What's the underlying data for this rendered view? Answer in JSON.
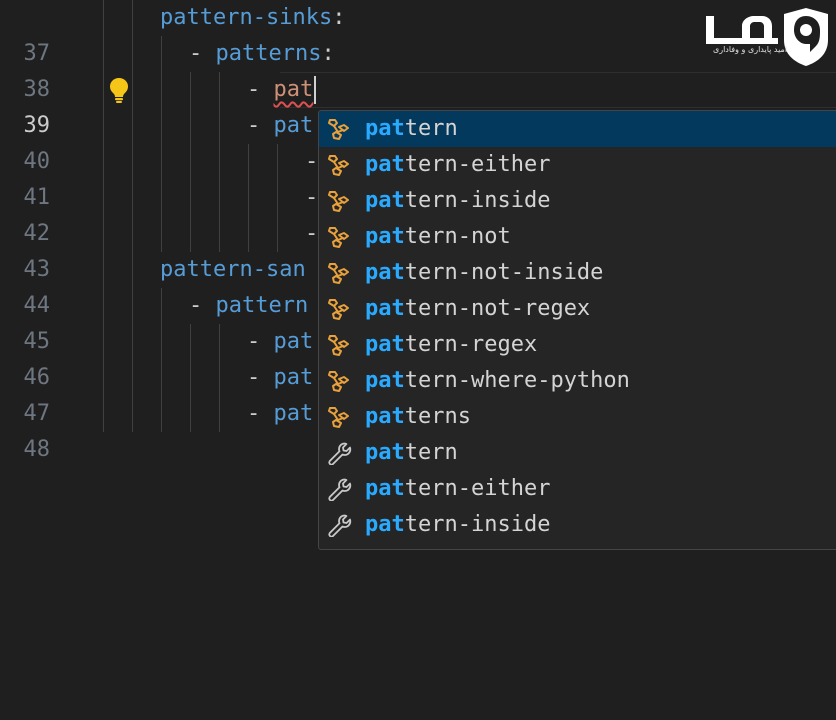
{
  "editor": {
    "lines": [
      {
        "num": "37",
        "indent": "",
        "dash": "",
        "text": "pattern-sinks",
        "suffix": ":",
        "typed": "",
        "active": false
      },
      {
        "num": "38",
        "indent": "  ",
        "dash": "- ",
        "text": "patterns",
        "suffix": ":",
        "typed": "",
        "active": false
      },
      {
        "num": "39",
        "indent": "",
        "dash": "- ",
        "text": "",
        "suffix": "",
        "typed": "pat",
        "active": true
      },
      {
        "num": "40",
        "indent": "",
        "dash": "- ",
        "text": "pat",
        "suffix": "",
        "typed": "",
        "active": false
      },
      {
        "num": "41",
        "indent": "",
        "dash": "-",
        "text": "",
        "suffix": "",
        "typed": "",
        "active": false
      },
      {
        "num": "42",
        "indent": "",
        "dash": "-",
        "text": "",
        "suffix": "",
        "typed": "",
        "active": false
      },
      {
        "num": "43",
        "indent": "",
        "dash": "-",
        "text": "",
        "suffix": "",
        "typed": "",
        "active": false
      },
      {
        "num": "44",
        "indent": "",
        "dash": "",
        "text": "pattern-san",
        "suffix": "",
        "typed": "",
        "active": false
      },
      {
        "num": "45",
        "indent": "",
        "dash": "- ",
        "text": "pattern",
        "suffix": "",
        "typed": "",
        "active": false
      },
      {
        "num": "46",
        "indent": "",
        "dash": "- ",
        "text": "pat",
        "suffix": "",
        "typed": "",
        "active": false
      },
      {
        "num": "47",
        "indent": "",
        "dash": "- ",
        "text": "pat",
        "suffix": "",
        "typed": "",
        "active": false
      },
      {
        "num": "48",
        "indent": "",
        "dash": "- ",
        "text": "pat",
        "suffix": "",
        "typed": "",
        "active": false
      }
    ]
  },
  "suggest": {
    "match_prefix": "pat",
    "items": [
      {
        "rest": "tern",
        "kind": "snippet-icon",
        "selected": true
      },
      {
        "rest": "tern-either",
        "kind": "snippet-icon",
        "selected": false
      },
      {
        "rest": "tern-inside",
        "kind": "snippet-icon",
        "selected": false
      },
      {
        "rest": "tern-not",
        "kind": "snippet-icon",
        "selected": false
      },
      {
        "rest": "tern-not-inside",
        "kind": "snippet-icon",
        "selected": false
      },
      {
        "rest": "tern-not-regex",
        "kind": "snippet-icon",
        "selected": false
      },
      {
        "rest": "tern-regex",
        "kind": "snippet-icon",
        "selected": false
      },
      {
        "rest": "tern-where-python",
        "kind": "snippet-icon",
        "selected": false
      },
      {
        "rest": "terns",
        "kind": "snippet-icon",
        "selected": false
      },
      {
        "rest": "tern",
        "kind": "property-wrench-icon",
        "selected": false
      },
      {
        "rest": "tern-either",
        "kind": "property-wrench-icon",
        "selected": false
      },
      {
        "rest": "tern-inside",
        "kind": "property-wrench-icon",
        "selected": false
      }
    ]
  },
  "logo": {
    "subtitle": "امید پایداری و وفاداری"
  },
  "colors": {
    "key": "#569cd6",
    "match": "#2aaaff",
    "typed": "#ce9178",
    "bulb": "#f5c518",
    "snippet_icon": "#e8a13c",
    "selection": "#04395e"
  }
}
